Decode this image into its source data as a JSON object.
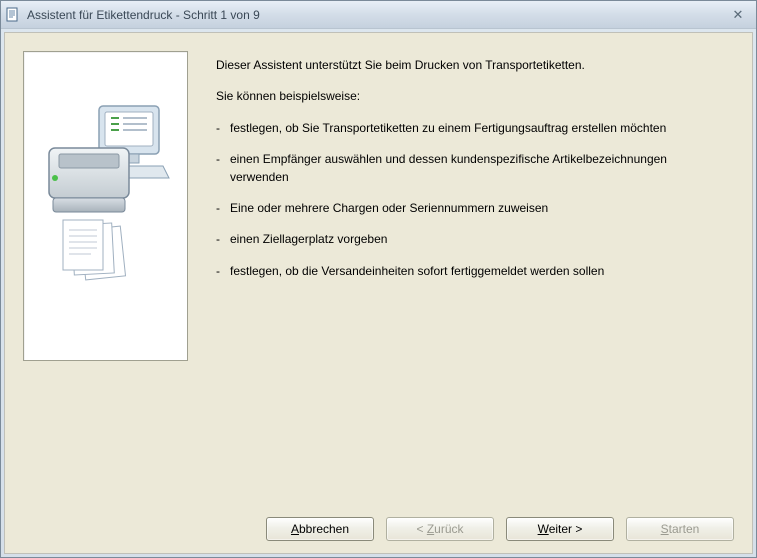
{
  "window": {
    "title": "Assistent für Etikettendruck - Schritt 1 von 9"
  },
  "content": {
    "intro": "Dieser Assistent unterstützt Sie beim Drucken von Transportetiketten.",
    "subintro": "Sie können beispielsweise:",
    "bullets": [
      "festlegen, ob Sie Transportetiketten zu einem Fertigungsauftrag erstellen möchten",
      "einen Empfänger auswählen und dessen kundenspezifische Artikelbezeichnungen verwenden",
      "Eine oder mehrere Chargen oder Seriennummern zuweisen",
      "einen Ziellagerplatz vorgeben",
      "festlegen, ob die Versandeinheiten sofort fertiggemeldet werden sollen"
    ]
  },
  "buttons": {
    "cancel_prefix": "A",
    "cancel_rest": "bbrechen",
    "back_prefix": "< ",
    "back_u": "Z",
    "back_rest": "urück",
    "next_u": "W",
    "next_rest": "eiter >",
    "start_prefix": "",
    "start_u": "S",
    "start_rest": "tarten"
  }
}
